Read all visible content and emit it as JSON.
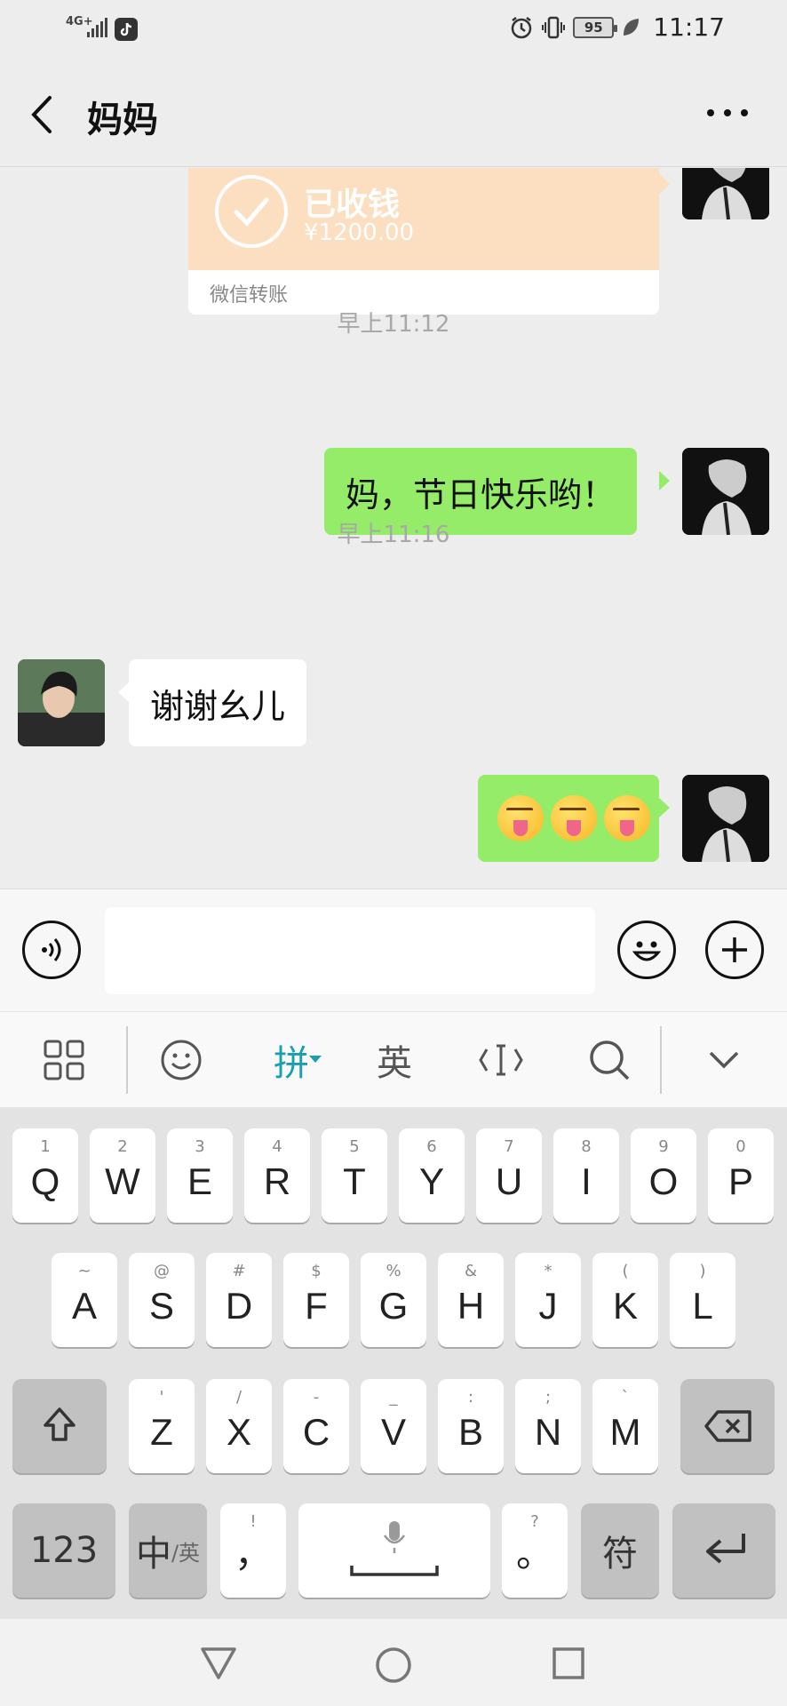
{
  "status_bar": {
    "network": "4G+",
    "battery": "95",
    "time": "11:17"
  },
  "header": {
    "title": "妈妈"
  },
  "messages": {
    "transfer": {
      "status": "已收钱",
      "amount": "¥1200.00",
      "label": "微信转账"
    },
    "time1": "早上11:12",
    "msg1": "妈，节日快乐哟！",
    "time2": "早上11:16",
    "msg2": "谢谢幺儿"
  },
  "ime": {
    "pinyin": "拼",
    "english": "英"
  },
  "keyboard": {
    "row1": [
      {
        "main": "Q",
        "sub": "1"
      },
      {
        "main": "W",
        "sub": "2"
      },
      {
        "main": "E",
        "sub": "3"
      },
      {
        "main": "R",
        "sub": "4"
      },
      {
        "main": "T",
        "sub": "5"
      },
      {
        "main": "Y",
        "sub": "6"
      },
      {
        "main": "U",
        "sub": "7"
      },
      {
        "main": "I",
        "sub": "8"
      },
      {
        "main": "O",
        "sub": "9"
      },
      {
        "main": "P",
        "sub": "0"
      }
    ],
    "row2": [
      {
        "main": "A",
        "sub": "~"
      },
      {
        "main": "S",
        "sub": "@"
      },
      {
        "main": "D",
        "sub": "#"
      },
      {
        "main": "F",
        "sub": "$"
      },
      {
        "main": "G",
        "sub": "%"
      },
      {
        "main": "H",
        "sub": "&"
      },
      {
        "main": "J",
        "sub": "*"
      },
      {
        "main": "K",
        "sub": "("
      },
      {
        "main": "L",
        "sub": ")"
      }
    ],
    "row3": [
      {
        "main": "Z",
        "sub": "'"
      },
      {
        "main": "X",
        "sub": "/"
      },
      {
        "main": "C",
        "sub": "-"
      },
      {
        "main": "V",
        "sub": "_"
      },
      {
        "main": "B",
        "sub": ":"
      },
      {
        "main": "N",
        "sub": ";"
      },
      {
        "main": "M",
        "sub": "`"
      }
    ],
    "num_key": "123",
    "lang_key_main": "中",
    "lang_key_sub": "/英",
    "comma_key": "，",
    "comma_sub": "!",
    "period_key": "。",
    "period_sub": "?",
    "symbol_key": "符"
  },
  "colors": {
    "my_bubble": "#95ec69",
    "their_bubble": "#ffffff",
    "transfer_bg": "#fcdfc0",
    "ime_accent": "#1a9fb0"
  }
}
